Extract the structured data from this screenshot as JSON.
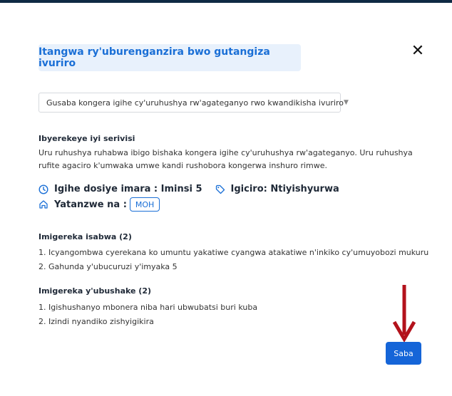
{
  "modal": {
    "title": "Itangwa ry'uburenganzira bwo gutangiza ivuriro",
    "close_label": "✕"
  },
  "service_select": {
    "value": "Gusaba kongera igihe cy'uruhushya rw'agateganyo rwo kwandikisha ivuriro"
  },
  "description": {
    "heading": "Ibyerekeye iyi serivisi",
    "text": "Uru ruhushya ruhabwa ibigo bishaka kongera igihe cy'uruhushya rw'agateganyo. Uru ruhushya rufite agaciro k'umwaka umwe kandi rushobora kongerwa inshuro rimwe."
  },
  "meta": {
    "duration": "Igihe dosiye imara : Iminsi 5",
    "price": "Igiciro: Ntiyishyurwa",
    "approved_by_label": "Yatanzwe na :",
    "approved_by_value": "MOH"
  },
  "required_docs": {
    "heading": "Imigereka isabwa (2)",
    "items": [
      "1. Icyangombwa cyerekana ko umuntu yakatiwe cyangwa atakatiwe n'inkiko cy'umuyobozi mukuru",
      "2. Gahunda y'ubucuruzi y'imyaka 5"
    ]
  },
  "optional_docs": {
    "heading": "Imigereka y'ubushake (2)",
    "items": [
      "1. Igishushanyo mbonera niba hari ubwubatsi buri kuba",
      "2. Izindi nyandiko zishyigikira"
    ]
  },
  "actions": {
    "submit_label": "Saba"
  },
  "colors": {
    "accent": "#1a6fd6",
    "button": "#1565d8",
    "arrow": "#b3121b",
    "title_bg": "#e8f1fc"
  },
  "icons": [
    "clock-icon",
    "tag-icon",
    "home-icon",
    "close-icon",
    "caret-down-icon",
    "arrow-down-icon"
  ]
}
